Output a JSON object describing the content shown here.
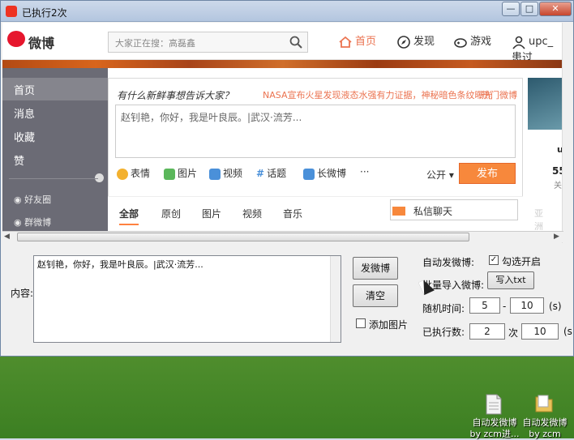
{
  "window": {
    "title": "已执行2次",
    "min_label": "—",
    "max_label": "□",
    "close_label": "✕"
  },
  "weibo": {
    "logo_text": "微博",
    "search_placeholder": "大家正在搜：高磊鑫",
    "nav": {
      "home": "首页",
      "discover": "发现",
      "games": "游戏",
      "user": "upc_患过"
    },
    "sidebar": {
      "home": "首页",
      "messages": "消息",
      "favorites": "收藏",
      "likes": "赞",
      "friends": "好友圈",
      "groups": "群微博"
    },
    "composer": {
      "slogan": "有什么新鲜事想告诉大家？",
      "news": "NASA宣布火星发现液态水强有力证据，神秘暗色条纹曝光",
      "hot": "热门微博",
      "text": "赵钊艳，你好，我是叶良辰。|武汉·流芳...",
      "tools": [
        "表情",
        "图片",
        "视频",
        "话题",
        "长微博",
        "···"
      ],
      "visibility": "公开",
      "publish": "发布"
    },
    "tabs": [
      "全部",
      "原创",
      "图片",
      "视频",
      "音乐"
    ],
    "private_chat": "私信聊天",
    "right_partial": {
      "name": "up",
      "count": "55",
      "label": "关",
      "faded": "亚洲"
    }
  },
  "form": {
    "content_label": "内容:",
    "content_text": "赵钊艳，你好，我是叶良辰。|武汉·流芳...",
    "send_button": "发微博",
    "clear_button": "清空",
    "add_image_label": "添加图片",
    "add_image_checked": false,
    "auto_post_label": "自动发微博:",
    "auto_check_label": "勾选开启",
    "auto_check_checked": true,
    "batch_import_label": "批量导入微博:",
    "write_txt_button": "写入txt",
    "random_time_label": "随机时间:",
    "random_min": "5",
    "dash": "-",
    "random_max": "10",
    "unit_s": "(s)",
    "executed_label": "已执行数:",
    "executed_count": "2",
    "times_label": "次",
    "limit_value": "10",
    "unit_s_partial": "(s"
  },
  "desktop": {
    "icons": [
      {
        "label1": "自动发微博",
        "label2": "by zcm进..."
      },
      {
        "label1": "自动发微博",
        "label2": "by zcm"
      }
    ]
  },
  "colors": {
    "weibo_red": "#e6162d",
    "weibo_orange": "#f7883c",
    "sidebar_gray": "#6b6b75"
  }
}
